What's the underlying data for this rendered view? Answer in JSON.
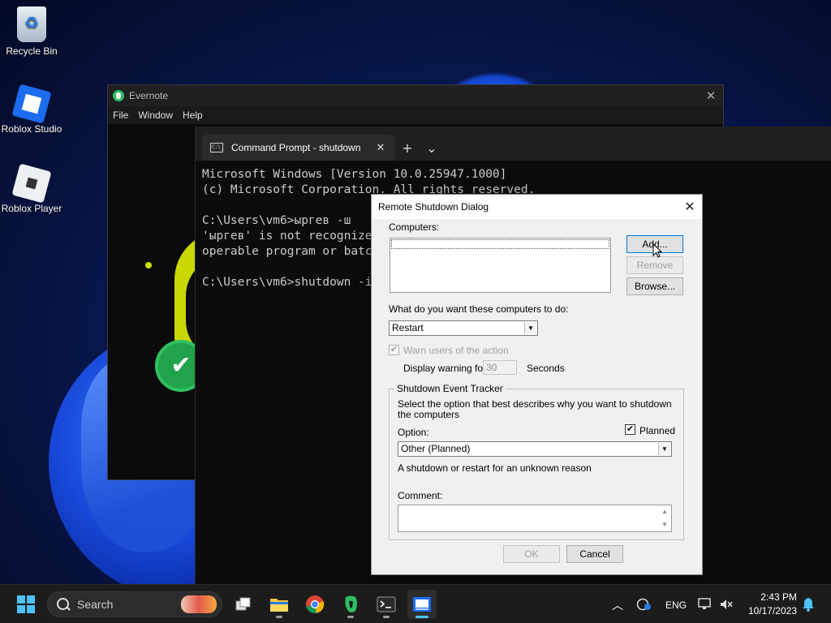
{
  "desktop": {
    "icons": [
      {
        "label": "Recycle Bin"
      },
      {
        "label": "Roblox Studio"
      },
      {
        "label": "Roblox Player"
      }
    ]
  },
  "evernote": {
    "title": "Evernote",
    "menu": [
      "File",
      "Window",
      "Help"
    ]
  },
  "terminal": {
    "tab_title": "Command Prompt - shutdown",
    "tab_icon_text": "C:\\_",
    "lines": [
      "Microsoft Windows [Version 10.0.25947.1000]",
      "(c) Microsoft Corporation. All rights reserved.",
      "",
      "C:\\Users\\vm6>ыргев -ш",
      "'ыргев' is not recognized as an internal or external command,",
      "operable program or batch file.",
      "",
      "C:\\Users\\vm6>shutdown -i"
    ]
  },
  "dialog": {
    "title": "Remote Shutdown Dialog",
    "computers_label": "Computers:",
    "add_label": "Add...",
    "remove_label": "Remove",
    "browse_label": "Browse...",
    "action_label": "What do you want these computers to do:",
    "action_value": "Restart",
    "warn_label": "Warn users of the action",
    "display_warning_label": "Display warning for",
    "warning_seconds": "30",
    "seconds_label": "Seconds",
    "tracker_label": "Shutdown Event Tracker",
    "tracker_desc": "Select the option that best describes why you want to shutdown the computers",
    "option_label": "Option:",
    "planned_label": "Planned",
    "option_value": "Other (Planned)",
    "option_desc": "A shutdown or restart for an unknown reason",
    "comment_label": "Comment:",
    "ok_label": "OK",
    "cancel_label": "Cancel"
  },
  "taskbar": {
    "search_label": "Search",
    "language": "ENG",
    "time": "2:43 PM",
    "date": "10/17/2023"
  }
}
